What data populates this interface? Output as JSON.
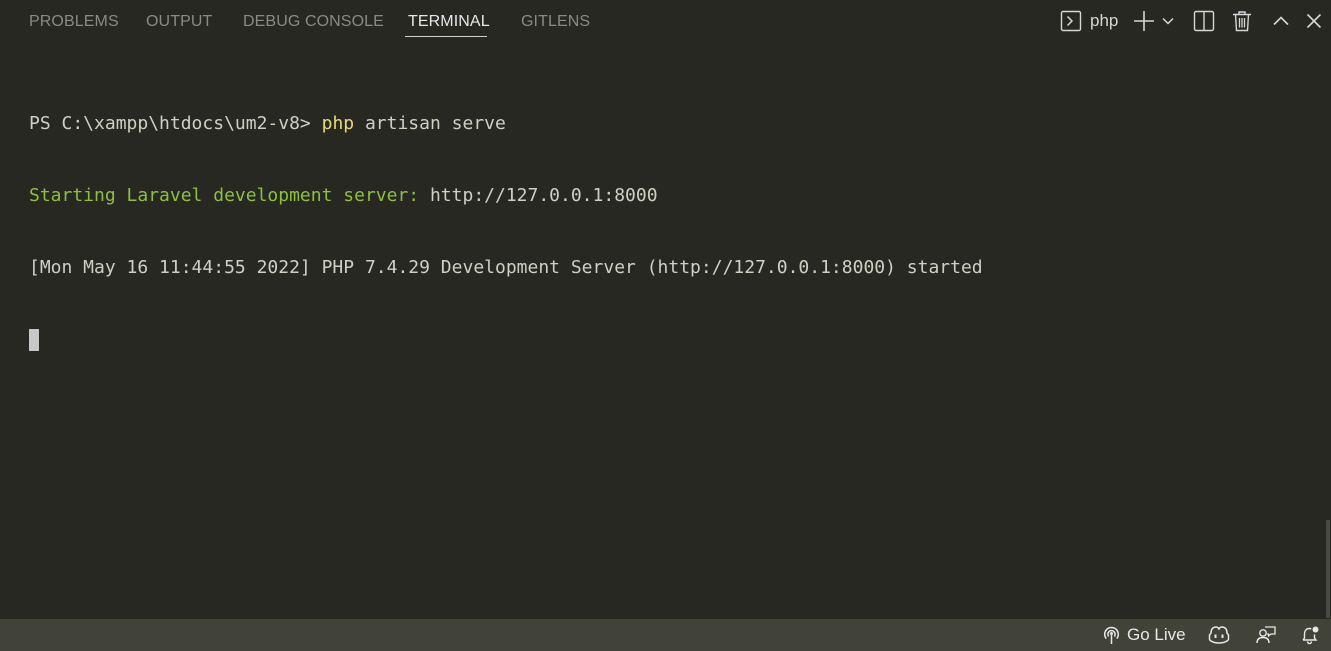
{
  "panel": {
    "tabs": [
      {
        "label": "PROBLEMS",
        "active": false
      },
      {
        "label": "OUTPUT",
        "active": false
      },
      {
        "label": "DEBUG CONSOLE",
        "active": false
      },
      {
        "label": "TERMINAL",
        "active": true
      },
      {
        "label": "GITLENS",
        "active": false
      }
    ],
    "shell_icon": "terminal-icon",
    "shell_label": "php",
    "actions": [
      "plus-icon",
      "chevron-down-icon",
      "split-icon",
      "trash-icon",
      "chevron-up-icon",
      "close-icon"
    ]
  },
  "terminal": {
    "line1": {
      "prompt": "PS C:\\xampp\\htdocs\\um2-v8> ",
      "command": "php",
      "args": " artisan serve"
    },
    "line2": {
      "status": "Starting Laravel development server: ",
      "url": "http://127.0.0.1:8000"
    },
    "line3": {
      "text": "[Mon May 16 11:44:55 2022] PHP 7.4.29 Development Server (http://127.0.0.1:8000) started"
    }
  },
  "status_bar": {
    "go_live_icon": "broadcast-icon",
    "go_live_label": "Go Live",
    "items": [
      "copilot-icon",
      "feedback-icon",
      "bell-icon"
    ]
  },
  "colors": {
    "background": "#272822",
    "status_bar": "#414339",
    "green": "#8ec03d",
    "yellow": "#e6db74"
  }
}
